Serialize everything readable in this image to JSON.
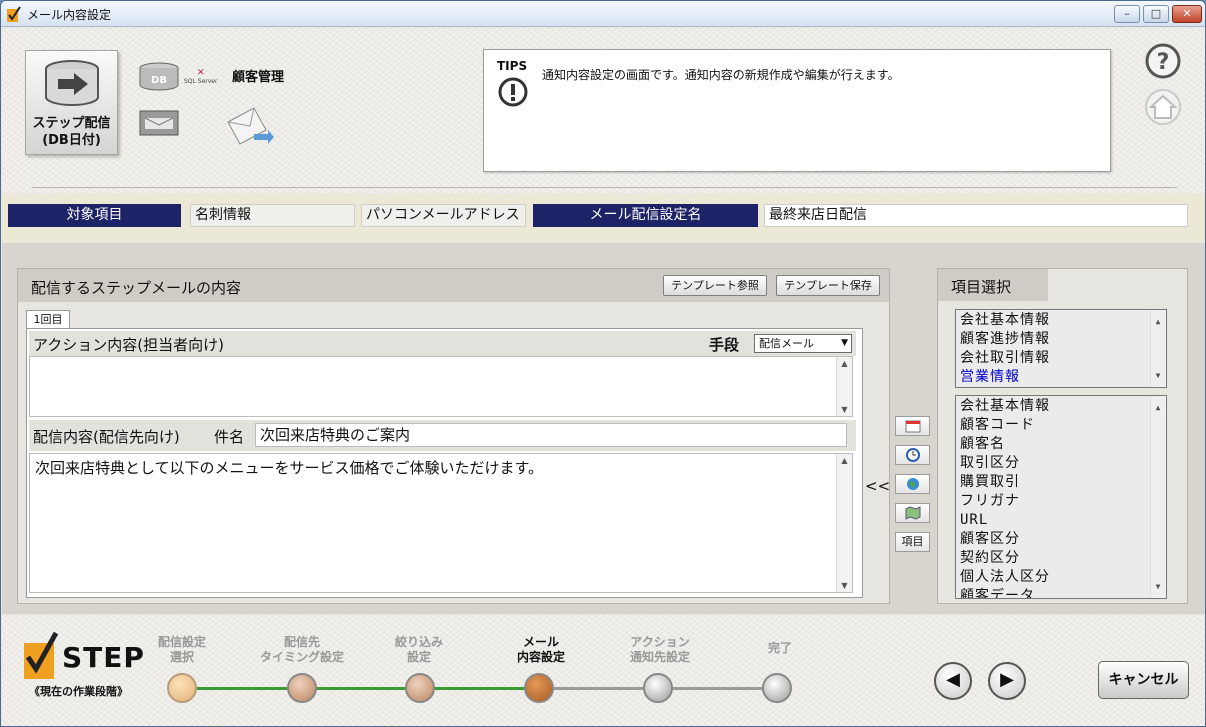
{
  "window": {
    "title": "メール内容設定",
    "min": "–",
    "max": "□",
    "close": "✕"
  },
  "header": {
    "step_button_lines": [
      "ステップ配信",
      "(DB日付)"
    ],
    "db_label": "DB",
    "sql_label": "SQL Server",
    "kokyaku": "顧客管理",
    "tips_label": "TIPS",
    "tips_text": "通知内容設定の画面です。通知内容の新規作成や編集が行えます。"
  },
  "target": {
    "label1": "対象項目",
    "value1": "名刺情報",
    "value2": "パソコンメールアドレス",
    "label2": "メール配信設定名",
    "value3": "最終来店日配信"
  },
  "left": {
    "title": "配信するステップメールの内容",
    "template_ref": "テンプレート参照",
    "template_save": "テンプレート保存",
    "tab": "1回目",
    "action_label": "アクション内容(担当者向け)",
    "method_label": "手段",
    "method_value": "配信メール",
    "delivery_label": "配信内容(配信先向け)",
    "subject_label": "件名",
    "subject_value": "次回来店特典のご案内",
    "body": "次回来店特典として以下のメニューをサービス価格でご体験いただけます。"
  },
  "tools": {
    "chevron": "<<",
    "item_btn": "項目"
  },
  "right": {
    "title": "項目選択",
    "categories": [
      "会社基本情報",
      "顧客進捗情報",
      "会社取引情報",
      "営業情報"
    ],
    "fields": [
      "会社基本情報",
      "顧客コード",
      "顧客名",
      "取引区分",
      "購買取引",
      "フリガナ",
      "URL",
      "顧客区分",
      "契約区分",
      "個人法人区分",
      "顧客データ"
    ]
  },
  "steps": {
    "logo": "STEP",
    "sub": "《現在の作業段階》",
    "items": [
      {
        "l1": "配信設定",
        "l2": "選択"
      },
      {
        "l1": "配信先",
        "l2": "タイミング設定"
      },
      {
        "l1": "絞り込み",
        "l2": "設定"
      },
      {
        "l1": "メール",
        "l2": "内容設定"
      },
      {
        "l1": "アクション",
        "l2": "通知先設定"
      },
      {
        "l1": "完了",
        "l2": ""
      }
    ],
    "prev": "◀",
    "next": "▶",
    "cancel": "キャンセル"
  },
  "colors": {
    "nav_label": "#1d2366",
    "done_line": "#3a9a33",
    "current_circle": "#b8692a"
  }
}
